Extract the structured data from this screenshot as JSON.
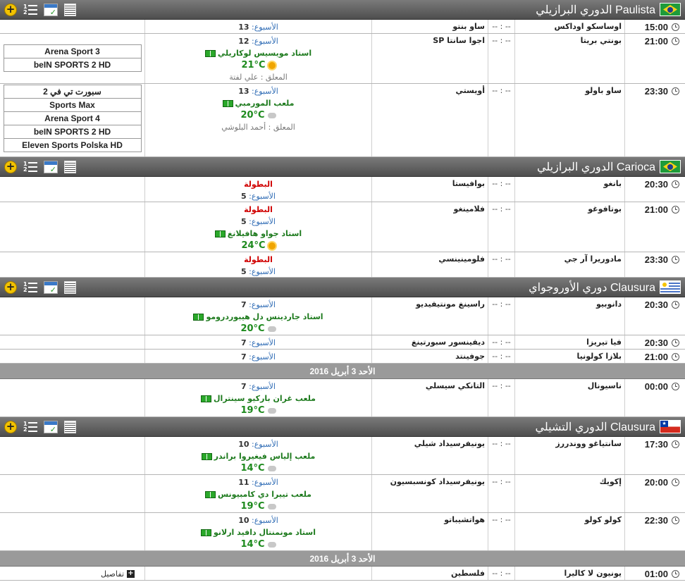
{
  "score_placeholder": "-- : --",
  "leagues": [
    {
      "id": "paulista",
      "title": "الدوري البرازيلي Paulista",
      "flag": "brazil-flag",
      "matches": [
        {
          "time": "15:00",
          "home": "اوساسكو اوداكس",
          "score": "-- : --",
          "away": "ساو بنتو",
          "week_label": "الأسبوع:",
          "week": "13",
          "channels": []
        },
        {
          "time": "21:00",
          "home": "بونتي بريتا",
          "score": "-- : --",
          "away": "اجوا سانتا SP",
          "week_label": "الأسبوع:",
          "week": "12",
          "stadium": "استاد مويسيس لوكاريلي",
          "temp": "21°C",
          "weather": "sunny",
          "commentator": "المعلق : علي لفتة",
          "channels": [
            "Arena Sport 3",
            "beIN SPORTS 2 HD"
          ]
        },
        {
          "time": "23:30",
          "home": "ساو باولو",
          "score": "-- : --",
          "away": "أويستي",
          "week_label": "الأسبوع:",
          "week": "13",
          "stadium": "ملعب المورمبي",
          "temp": "20°C",
          "weather": "cloudy",
          "commentator": "المعلق : أحمد البلوشي",
          "channels": [
            "سبورت تي في 2",
            "Sports Max",
            "Arena Sport 4",
            "beIN SPORTS 2 HD",
            "Eleven Sports Polska HD"
          ]
        }
      ]
    },
    {
      "id": "carioca",
      "title": "الدوري البرازيلي Carioca",
      "flag": "brazil-flag",
      "matches": [
        {
          "time": "20:30",
          "home": "بانغو",
          "score": "-- : --",
          "away": "بوافيستا",
          "tournament": "البطولة",
          "week_label": "الأسبوع:",
          "week": "5",
          "channels": []
        },
        {
          "time": "21:00",
          "home": "بوتافوغو",
          "score": "-- : --",
          "away": "فلامينغو",
          "tournament": "البطولة",
          "week_label": "الأسبوع:",
          "week": "5",
          "stadium": "استاد جواو هافيلانغ",
          "temp": "24°C",
          "weather": "sunny",
          "channels": []
        },
        {
          "time": "23:30",
          "home": "مادوريرا آر جي",
          "score": "-- : --",
          "away": "فلومينينسي",
          "tournament": "البطولة",
          "week_label": "الأسبوع:",
          "week": "5",
          "channels": []
        }
      ]
    },
    {
      "id": "uruguay",
      "title": "دوري الأوروجواي Clausura",
      "flag": "uruguay-flag",
      "matches": [
        {
          "time": "20:30",
          "home": "دانوبيو",
          "score": "-- : --",
          "away": "راسينغ مونتيفيديو",
          "week_label": "الأسبوع:",
          "week": "7",
          "stadium": "استاد جاردينس دل هيبوردرومو",
          "temp": "20°C",
          "weather": "cloudy",
          "channels": []
        },
        {
          "time": "20:30",
          "home": "فيا تيريزا",
          "score": "-- : --",
          "away": "ديفينسور سبورتينغ",
          "week_label": "الأسبوع:",
          "week": "7",
          "channels": []
        },
        {
          "time": "21:00",
          "home": "بلازا كولونيا",
          "score": "-- : --",
          "away": "جوفينتد",
          "week_label": "الأسبوع:",
          "week": "7",
          "channels": []
        }
      ],
      "date_separator": "الأحد 3 أبريل 2016",
      "after_date": [
        {
          "time": "00:00",
          "home": "ناسيونال",
          "score": "-- : --",
          "away": "التانكي سيسلي",
          "week_label": "الأسبوع:",
          "week": "7",
          "stadium": "ملعب غران باركيو سينترال",
          "temp": "19°C",
          "weather": "cloudy",
          "channels": []
        }
      ]
    },
    {
      "id": "chile",
      "title": "الدوري التشيلي Clausura",
      "flag": "chile-flag",
      "matches": [
        {
          "time": "17:30",
          "home": "سانتياغو ووندررز",
          "score": "-- : --",
          "away": "يونيفرسيداد شيلي",
          "week_label": "الأسبوع:",
          "week": "10",
          "stadium": "ملعب إلياس فيغيروا براندر",
          "temp": "14°C",
          "weather": "cloudy",
          "channels": []
        },
        {
          "time": "20:00",
          "home": "إكويك",
          "score": "-- : --",
          "away": "يونيفرسيداد كونسبسيون",
          "week_label": "الأسبوع:",
          "week": "11",
          "stadium": "ملعب تييرا دي كامبيونس",
          "temp": "19°C",
          "weather": "cloudy",
          "channels": []
        },
        {
          "time": "22:30",
          "home": "كولو كولو",
          "score": "-- : --",
          "away": "هواتشيباتو",
          "week_label": "الأسبوع:",
          "week": "10",
          "stadium": "استاد مونمنتال دافيد ارلانو",
          "temp": "14°C",
          "weather": "cloudy",
          "channels": []
        }
      ],
      "date_separator": "الأحد 3 أبريل 2016",
      "after_date": [
        {
          "time": "01:00",
          "home": "يونيون لا كاليرا",
          "score": "-- : --",
          "away": "فلسطين",
          "details": "تفاصيل",
          "channels": []
        }
      ]
    }
  ]
}
